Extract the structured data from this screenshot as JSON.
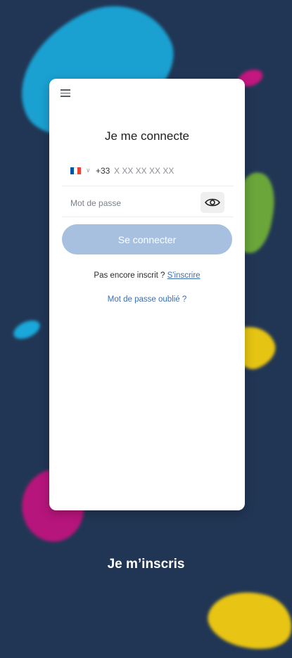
{
  "login": {
    "title": "Je me connecte",
    "country_prefix": "+33",
    "country_flag_colors": [
      "#0055A4",
      "#FFFFFF",
      "#EF4135"
    ],
    "phone_placeholder": "X XX XX XX XX",
    "password_placeholder": "Mot de passe",
    "connect_label": "Se connecter",
    "signup_prompt": "Pas encore inscrit ?",
    "signup_link": "S'inscrire",
    "forgot_password": "Mot de passe oublié ?"
  },
  "footer": {
    "signup_cta": "Je m’inscris"
  },
  "icons": {
    "menu": "menu-icon",
    "eye": "eye-icon",
    "chevron": "chevron-down-icon",
    "flag": "france-flag-icon"
  },
  "colors": {
    "background": "#213655",
    "button_disabled": "#A7C0E0",
    "link": "#3C6FB4"
  }
}
